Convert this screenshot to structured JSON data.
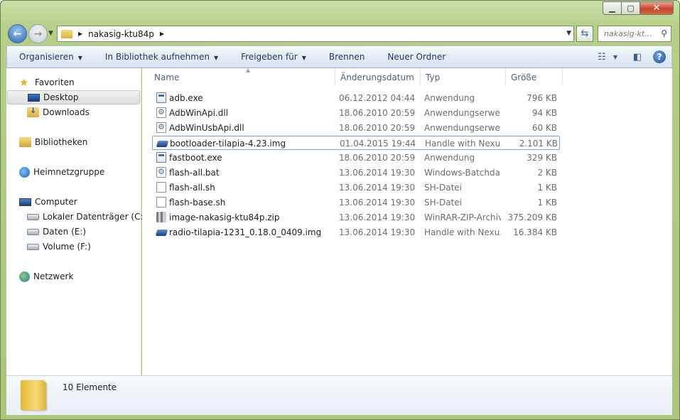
{
  "window": {
    "title_buttons": {
      "minimize_icon": "minimize-icon",
      "maximize_icon": "maximize-icon",
      "close_label": "✕"
    }
  },
  "address": {
    "crumb": "nakasig-ktu84p",
    "search_placeholder": "nakasig-kt..."
  },
  "toolbar": {
    "organize": "Organisieren",
    "include_library": "In Bibliothek aufnehmen",
    "share": "Freigeben für",
    "burn": "Brennen",
    "new_folder": "Neuer Ordner"
  },
  "sidebar": {
    "favorites": "Favoriten",
    "desktop": "Desktop",
    "downloads": "Downloads",
    "libraries": "Bibliotheken",
    "homegroup": "Heimnetzgruppe",
    "computer": "Computer",
    "drive_c": "Lokaler Datenträger (C:)",
    "drive_e": "Daten (E:)",
    "drive_f": "Volume (F:)",
    "network": "Netzwerk"
  },
  "columns": {
    "name": "Name",
    "date": "Änderungsdatum",
    "type": "Typ",
    "size": "Größe"
  },
  "files": [
    {
      "name": "adb.exe",
      "date": "06.12.2012 04:44",
      "type": "Anwendung",
      "size": "796 KB",
      "icon": "exe"
    },
    {
      "name": "AdbWinApi.dll",
      "date": "18.06.2010 20:59",
      "type": "Anwendungserwe...",
      "size": "94 KB",
      "icon": "dll"
    },
    {
      "name": "AdbWinUsbApi.dll",
      "date": "18.06.2010 20:59",
      "type": "Anwendungserwe...",
      "size": "60 KB",
      "icon": "dll"
    },
    {
      "name": "bootloader-tilapia-4.23.img",
      "date": "01.04.2015 19:44",
      "type": "Handle with Nexu...",
      "size": "2.101 KB",
      "icon": "img"
    },
    {
      "name": "fastboot.exe",
      "date": "18.06.2010 20:59",
      "type": "Anwendung",
      "size": "329 KB",
      "icon": "exe"
    },
    {
      "name": "flash-all.bat",
      "date": "13.06.2014 19:30",
      "type": "Windows-Batchda...",
      "size": "2 KB",
      "icon": "bat"
    },
    {
      "name": "flash-all.sh",
      "date": "13.06.2014 19:30",
      "type": "SH-Datei",
      "size": "1 KB",
      "icon": "file"
    },
    {
      "name": "flash-base.sh",
      "date": "13.06.2014 19:30",
      "type": "SH-Datei",
      "size": "1 KB",
      "icon": "file"
    },
    {
      "name": "image-nakasig-ktu84p.zip",
      "date": "13.06.2014 19:30",
      "type": "WinRAR-ZIP-Archiv",
      "size": "375.209 KB",
      "icon": "zip"
    },
    {
      "name": "radio-tilapia-1231_0.18.0_0409.img",
      "date": "13.06.2014 19:30",
      "type": "Handle with Nexu...",
      "size": "16.384 KB",
      "icon": "img"
    }
  ],
  "details": {
    "count": "10 Elemente"
  }
}
